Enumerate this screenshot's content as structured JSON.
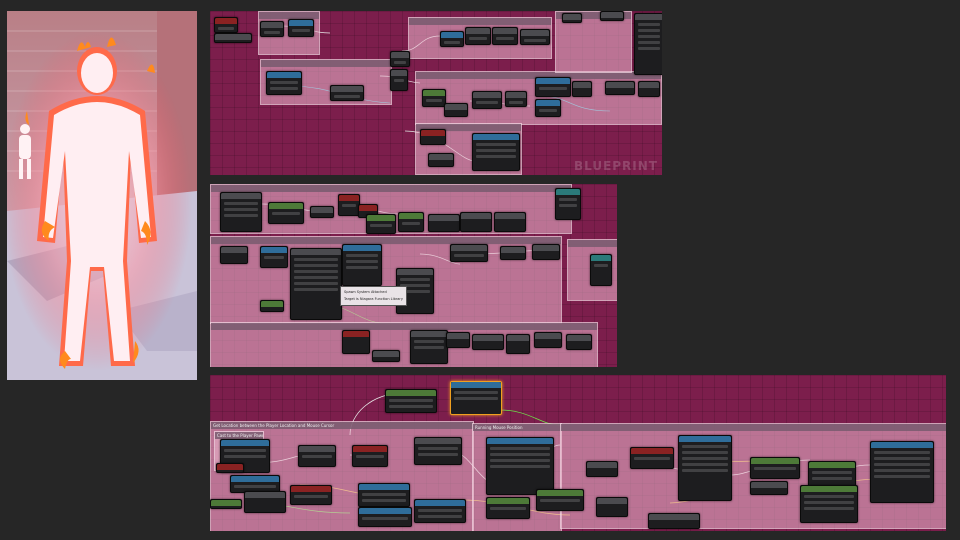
{
  "watermark": "BLUEPRINT",
  "tooltip": {
    "line1": "Spawn System Attached",
    "line2": "Target is Niagara Function Library"
  },
  "colors": {
    "canvas": "#7c1e4c",
    "comment": "#eebad0",
    "node_body": "#1d1d1f",
    "header_blue": "#2f6d9a",
    "header_green": "#4d7a38",
    "header_red": "#8a2222",
    "fire": "#ff5a2a"
  },
  "graph3": {
    "comment_main": "Get Location between the Player Location and Mouse Cursor",
    "comment_sub": "Cast to the Player Pawn",
    "comment_right": "Running Mouse Position"
  }
}
